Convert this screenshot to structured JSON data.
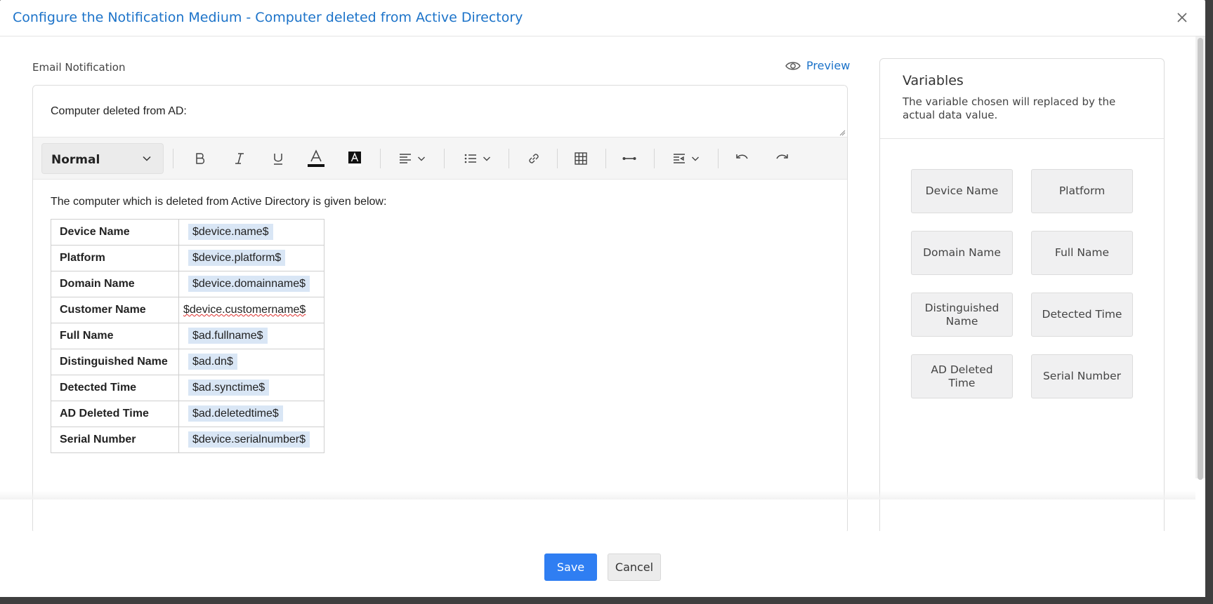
{
  "dialog": {
    "title": "Configure the Notification Medium - Computer deleted from Active Directory"
  },
  "email": {
    "section_label": "Email Notification",
    "preview_label": "Preview",
    "subject": "Computer deleted from AD:"
  },
  "toolbar": {
    "format_selected": "Normal",
    "icons": [
      "bold-icon",
      "italic-icon",
      "underline-icon",
      "font-color-icon",
      "background-color-icon",
      "align-icon",
      "list-icon",
      "link-icon",
      "table-icon",
      "horizontal-rule-icon",
      "insert-icon",
      "undo-icon",
      "redo-icon"
    ]
  },
  "body": {
    "intro": "The computer which is deleted from Active Directory is given below:",
    "rows": [
      {
        "key": "Device Name",
        "value": "$device.name$"
      },
      {
        "key": "Platform",
        "value": "$device.platform$"
      },
      {
        "key": "Domain Name",
        "value": "$device.domainname$"
      },
      {
        "key": "Customer Name",
        "value": "$device.customername$"
      },
      {
        "key": "Full Name",
        "value": "$ad.fullname$"
      },
      {
        "key": "Distinguished Name",
        "value": "$ad.dn$"
      },
      {
        "key": "Detected Time",
        "value": "$ad.synctime$"
      },
      {
        "key": "AD Deleted Time",
        "value": "$ad.deletedtime$"
      },
      {
        "key": "Serial Number",
        "value": "$device.serialnumber$"
      }
    ]
  },
  "variables": {
    "title": "Variables",
    "description": "The variable chosen will replaced by the actual data value.",
    "items": [
      "Device Name",
      "Platform",
      "Domain Name",
      "Full Name",
      "Distinguished Name",
      "Detected Time",
      "AD Deleted Time",
      "Serial Number"
    ]
  },
  "footer": {
    "save_label": "Save",
    "cancel_label": "Cancel"
  },
  "colors": {
    "accent": "#1c73c9",
    "primary_button": "#2f7ef2",
    "variable_highlight": "#d9e6f5"
  }
}
